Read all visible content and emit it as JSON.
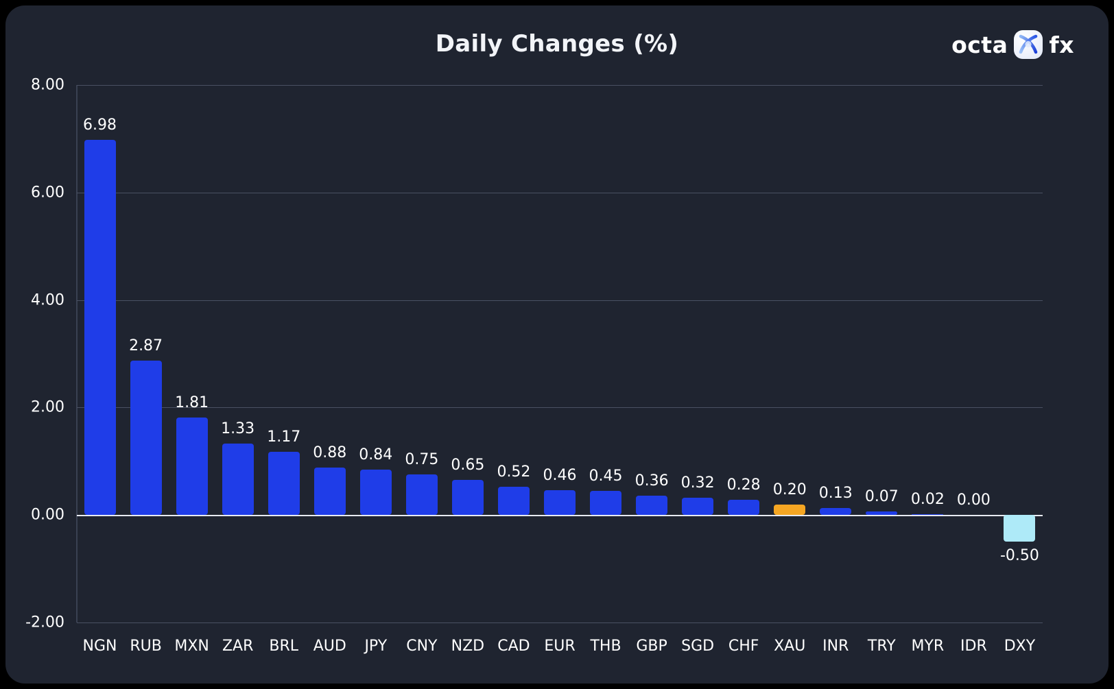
{
  "header": {
    "title": "Daily Changes (%)",
    "brand": {
      "word_left": "octa",
      "word_right": "fx",
      "mark_icon": "octa-x-logo-icon"
    }
  },
  "chart_data": {
    "type": "bar",
    "title": "Daily Changes (%)",
    "xlabel": "",
    "ylabel": "",
    "ylim": [
      -2.0,
      8.0
    ],
    "yticks": [
      "8.00",
      "6.00",
      "4.00",
      "2.00",
      "0.00",
      "-2.00"
    ],
    "ytick_values": [
      8,
      6,
      4,
      2,
      0,
      -2
    ],
    "grid": true,
    "legend": "none",
    "data_labels": true,
    "categories": [
      "NGN",
      "RUB",
      "MXN",
      "ZAR",
      "BRL",
      "AUD",
      "JPY",
      "CNY",
      "NZD",
      "CAD",
      "EUR",
      "THB",
      "GBP",
      "SGD",
      "CHF",
      "XAU",
      "INR",
      "TRY",
      "MYR",
      "IDR",
      "DXY"
    ],
    "values": [
      6.98,
      2.87,
      1.81,
      1.33,
      1.17,
      0.88,
      0.84,
      0.75,
      0.65,
      0.52,
      0.46,
      0.45,
      0.36,
      0.32,
      0.28,
      0.2,
      0.13,
      0.07,
      0.02,
      0.0,
      -0.5
    ],
    "value_labels": [
      "6.98",
      "2.87",
      "1.81",
      "1.33",
      "1.17",
      "0.88",
      "0.84",
      "0.75",
      "0.65",
      "0.52",
      "0.46",
      "0.45",
      "0.36",
      "0.32",
      "0.28",
      "0.20",
      "0.13",
      "0.07",
      "0.02",
      "0.00",
      "-0.50"
    ],
    "bar_colors": [
      "#1f3de8",
      "#1f3de8",
      "#1f3de8",
      "#1f3de8",
      "#1f3de8",
      "#1f3de8",
      "#1f3de8",
      "#1f3de8",
      "#1f3de8",
      "#1f3de8",
      "#1f3de8",
      "#1f3de8",
      "#1f3de8",
      "#1f3de8",
      "#1f3de8",
      "#f5a623",
      "#1f3de8",
      "#1f3de8",
      "#1f3de8",
      "#1f3de8",
      "#aeeaf8"
    ]
  },
  "colors": {
    "page_background": "#000000",
    "card_background": "#1f2430",
    "bar_default": "#1f3de8",
    "bar_highlight": "#f5a623",
    "bar_negative": "#aeeaf8",
    "grid": "#4a5163",
    "zero_line": "#e8ebf2",
    "text": "#ffffff"
  }
}
